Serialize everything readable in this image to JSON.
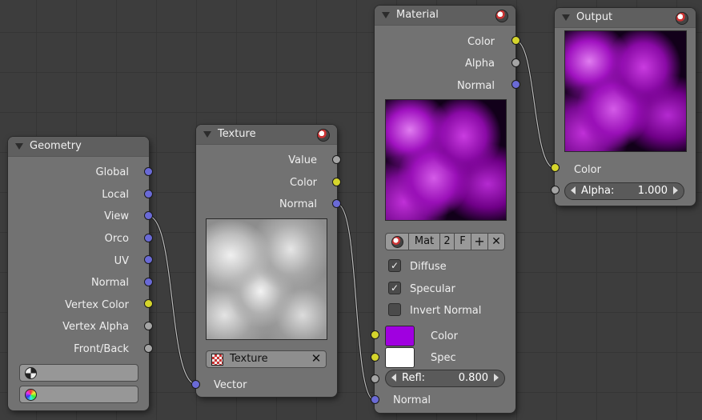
{
  "nodes": {
    "geometry": {
      "title": "Geometry",
      "outputs": [
        "Global",
        "Local",
        "View",
        "Orco",
        "UV",
        "Normal",
        "Vertex Color",
        "Vertex Alpha",
        "Front/Back"
      ]
    },
    "texture": {
      "title": "Texture",
      "outputs": [
        "Value",
        "Color",
        "Normal"
      ],
      "datablock": "Texture",
      "input": "Vector"
    },
    "material": {
      "title": "Material",
      "outputs": [
        "Color",
        "Alpha",
        "Normal"
      ],
      "mat_bar": {
        "name": "Mat",
        "users": "2",
        "fake": "F"
      },
      "checkboxes": [
        {
          "label": "Diffuse",
          "checked": true
        },
        {
          "label": "Specular",
          "checked": true
        },
        {
          "label": "Invert Normal",
          "checked": false
        }
      ],
      "inputs": {
        "color_label": "Color",
        "color_value": "#a000e0",
        "spec_label": "Spec",
        "spec_value": "#ffffff",
        "refl_label": "Refl:",
        "refl_value": "0.800",
        "normal_label": "Normal"
      }
    },
    "output": {
      "title": "Output",
      "color_label": "Color",
      "alpha_label": "Alpha:",
      "alpha_value": "1.000"
    }
  },
  "colors": {
    "background": "#3d3d3d",
    "node_body": "#727272",
    "socket_vector": "#6a6ad6",
    "socket_color": "#d5d52c",
    "socket_value": "#a5a5a5"
  }
}
